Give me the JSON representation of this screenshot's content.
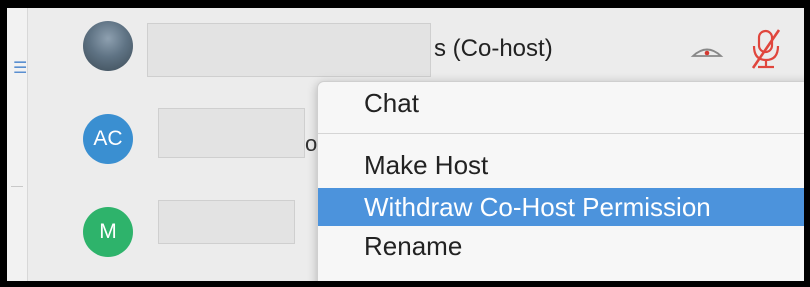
{
  "participants": [
    {
      "id": "p1",
      "avatar_type": "photo",
      "name_visible_suffix": "s (Co-host)",
      "icons": [
        "video-off-icon",
        "mic-muted-icon"
      ]
    },
    {
      "id": "p2",
      "avatar_type": "initials",
      "initials": "AC",
      "avatar_color": "#3a8fd1",
      "name_partial": "o"
    },
    {
      "id": "p3",
      "avatar_type": "initials",
      "initials": "M",
      "avatar_color": "#2eb36b"
    }
  ],
  "context_menu": {
    "items": [
      {
        "label": "Chat",
        "highlighted": false
      },
      {
        "label": "Make Host",
        "highlighted": false
      },
      {
        "label": "Withdraw Co-Host Permission",
        "highlighted": true
      },
      {
        "label": "Rename",
        "highlighted": false
      }
    ]
  },
  "colors": {
    "highlight": "#4c93dc",
    "mic_muted": "#e0463d",
    "video_icon": "#d43a32"
  }
}
